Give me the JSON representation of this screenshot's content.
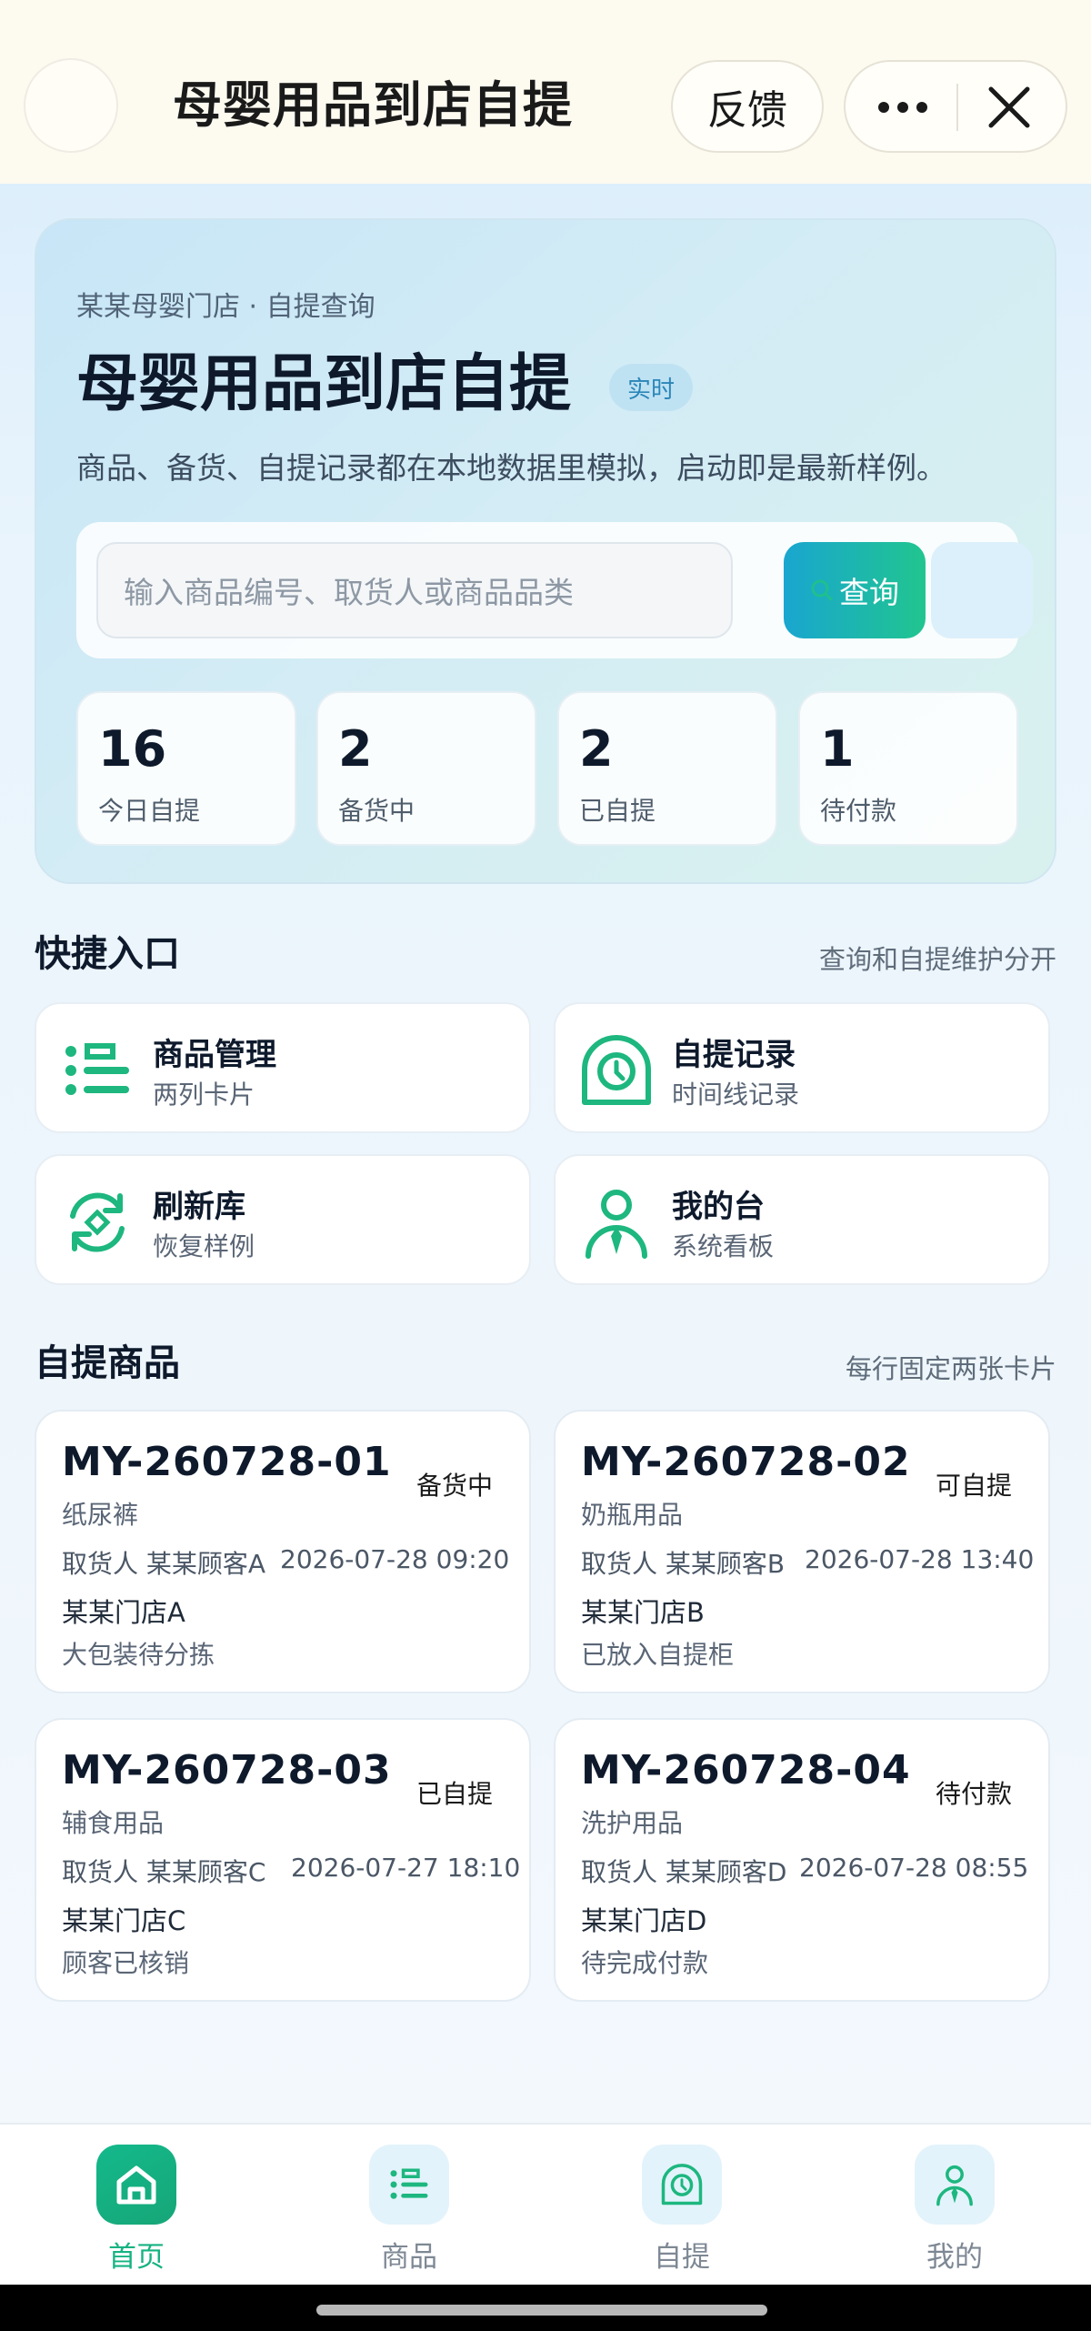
{
  "navbar": {
    "title": "母婴用品到店自提",
    "feedback_label": "反馈"
  },
  "hero": {
    "crumb": "某某母婴门店 · 自提查询",
    "title": "母婴用品到店自提",
    "badge": "实时",
    "description": "商品、备货、自提记录都在本地数据里模拟，启动即是最新样例。",
    "search_placeholder": "输入商品编号、取货人或商品品类",
    "search_button": "查询",
    "stats": [
      {
        "value": "16",
        "label": "今日自提"
      },
      {
        "value": "2",
        "label": "备货中"
      },
      {
        "value": "2",
        "label": "已自提"
      },
      {
        "value": "1",
        "label": "待付款"
      }
    ]
  },
  "quick_entry": {
    "title": "快捷入口",
    "note": "查询和自提维护分开",
    "items": [
      {
        "title": "商品管理",
        "subtitle": "两列卡片",
        "icon": "list-icon"
      },
      {
        "title": "自提记录",
        "subtitle": "时间线记录",
        "icon": "clock-icon"
      },
      {
        "title": "刷新库",
        "subtitle": "恢复样例",
        "icon": "refresh-icon"
      },
      {
        "title": "我的台",
        "subtitle": "系统看板",
        "icon": "user-icon"
      }
    ]
  },
  "products": {
    "title": "自提商品",
    "note": "每行固定两张卡片",
    "items": [
      {
        "id": "MY-260728-01",
        "status": "备货中",
        "category": "纸尿裤",
        "pickup": "取货人 某某顾客A",
        "time": "2026-07-28 09:20",
        "store": "某某门店A",
        "note": "大包装待分拣"
      },
      {
        "id": "MY-260728-02",
        "status": "可自提",
        "category": "奶瓶用品",
        "pickup": "取货人 某某顾客B",
        "time": "2026-07-28 13:40",
        "store": "某某门店B",
        "note": "已放入自提柜"
      },
      {
        "id": "MY-260728-03",
        "status": "已自提",
        "category": "辅食用品",
        "pickup": "取货人 某某顾客C",
        "time": "2026-07-27 18:10",
        "store": "某某门店C",
        "note": "顾客已核销"
      },
      {
        "id": "MY-260728-04",
        "status": "待付款",
        "category": "洗护用品",
        "pickup": "取货人 某某顾客D",
        "time": "2026-07-28 08:55",
        "store": "某某门店D",
        "note": "待完成付款"
      }
    ]
  },
  "tabbar": {
    "items": [
      {
        "label": "首页",
        "icon": "home-icon",
        "active": true
      },
      {
        "label": "商品",
        "icon": "list-icon"
      },
      {
        "label": "自提",
        "icon": "clock-icon"
      },
      {
        "label": "我的",
        "icon": "user-icon"
      }
    ]
  },
  "colors": {
    "accent_green": "#1db77f",
    "accent_blue": "#19a6d0"
  }
}
